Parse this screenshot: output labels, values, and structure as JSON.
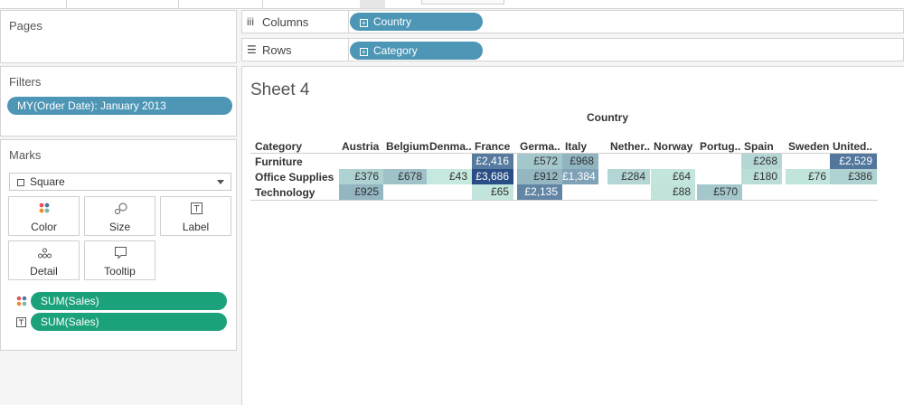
{
  "pages": {
    "title": "Pages"
  },
  "filters": {
    "title": "Filters",
    "items": [
      "MY(Order Date): January 2013"
    ]
  },
  "marks": {
    "title": "Marks",
    "mark_type": "Square",
    "buttons": {
      "color": "Color",
      "size": "Size",
      "label": "Label",
      "detail": "Detail",
      "tooltip": "Tooltip"
    },
    "fields": [
      {
        "role": "color",
        "label": "SUM(Sales)"
      },
      {
        "role": "label",
        "label": "SUM(Sales)"
      }
    ]
  },
  "shelves": {
    "columns": {
      "label": "Columns",
      "pill": "Country"
    },
    "rows": {
      "label": "Rows",
      "pill": "Category"
    }
  },
  "sheet": {
    "title": "Sheet 4"
  },
  "colors": {
    "pill_blue": "#4d96b6",
    "pill_green": "#1ba27a"
  },
  "chart_data": {
    "type": "heatmap",
    "title": "Sheet 4",
    "column_axis_title": "Country",
    "row_header": "Category",
    "columns": [
      "Austria",
      "Belgium",
      "Denma..",
      "France",
      "Germa..",
      "Italy",
      "Nether..",
      "Norway",
      "Portug..",
      "Spain",
      "Sweden",
      "United.."
    ],
    "rows": [
      "Furniture",
      "Office Supplies",
      "Technology"
    ],
    "values": [
      [
        null,
        null,
        null,
        2416,
        572,
        968,
        null,
        null,
        null,
        268,
        null,
        2529
      ],
      [
        376,
        678,
        43,
        3686,
        912,
        1384,
        284,
        64,
        null,
        180,
        76,
        386
      ],
      [
        925,
        null,
        null,
        65,
        2135,
        null,
        null,
        88,
        570,
        null,
        null,
        null
      ]
    ],
    "labels": [
      [
        "",
        "",
        "",
        "£2,416",
        "£572",
        "£968",
        "",
        "",
        "",
        "£268",
        "",
        "£2,529"
      ],
      [
        "£376",
        "£678",
        "£43",
        "£3,686",
        "£912",
        "£1,384",
        "£284",
        "£64",
        "",
        "£180",
        "£76",
        "£386"
      ],
      [
        "£925",
        "",
        "",
        "£65",
        "£2,135",
        "",
        "",
        "£88",
        "£570",
        "",
        "",
        ""
      ]
    ],
    "color_range": {
      "low": "#c5e8df",
      "high": "#2a4d85"
    }
  }
}
